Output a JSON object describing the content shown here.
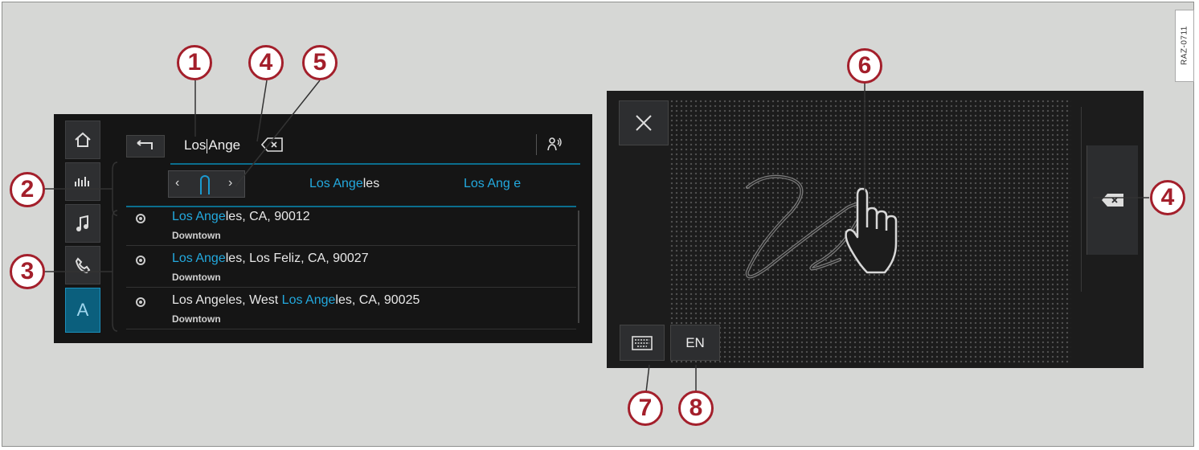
{
  "figure": {
    "ref_code": "RAZ-0711"
  },
  "left_screen": {
    "search": {
      "value_before_cursor": "Los",
      "value_after_cursor": "Ange"
    },
    "suggestions": [
      {
        "highlight": "Los Ange",
        "rest": "les"
      },
      {
        "highlight": "Los Ang e",
        "rest": ""
      }
    ],
    "results": [
      {
        "title_parts": [
          {
            "text": "Los Ange",
            "hl": true
          },
          {
            "text": "les, CA, 90012",
            "hl": false
          }
        ],
        "subtitle": "Downtown"
      },
      {
        "title_parts": [
          {
            "text": "Los Ange",
            "hl": true
          },
          {
            "text": "les, Los Feliz, CA, 90027",
            "hl": false
          }
        ],
        "subtitle": "Downtown"
      },
      {
        "title_parts": [
          {
            "text": "Los Angeles, West ",
            "hl": false
          },
          {
            "text": "Los Ange",
            "hl": true
          },
          {
            "text": "les, CA, 90025",
            "hl": false
          }
        ],
        "subtitle": "Downtown"
      }
    ],
    "sidebar": {
      "active_letter": "A"
    }
  },
  "right_screen": {
    "language_label": "EN"
  },
  "callouts": {
    "c1": "1",
    "c2": "2",
    "c3": "3",
    "c4_left": "4",
    "c4_right": "4",
    "c5": "5",
    "c6": "6",
    "c7": "7",
    "c8": "8"
  },
  "colors": {
    "highlight": "#23a9de",
    "callout": "#a31f2b",
    "accent_line": "#0b6e8e"
  }
}
